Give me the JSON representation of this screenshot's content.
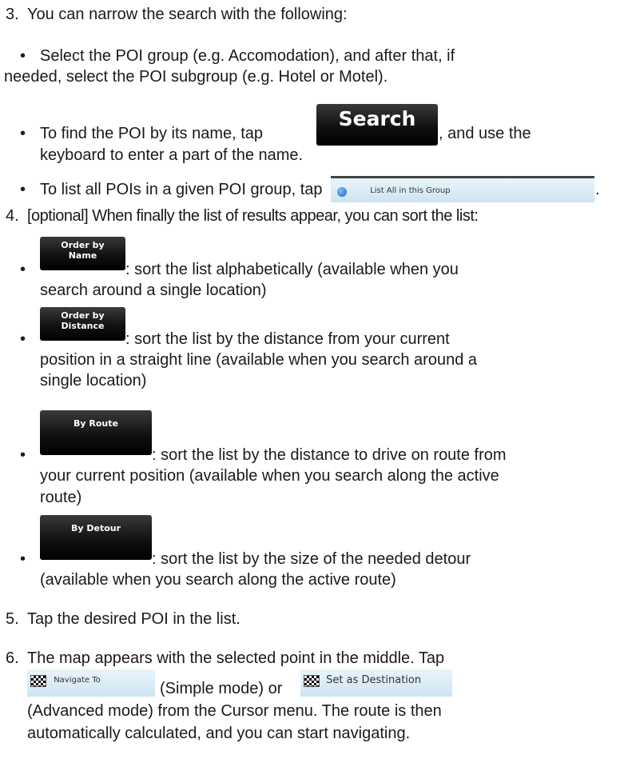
{
  "items": {
    "s3": {
      "num": "3.",
      "text": "You can narrow the search with the following:",
      "b1": {
        "line1": "Select the POI group (e.g. Accomodation), and after that, if",
        "line2": "needed, select the POI subgroup (e.g. Hotel or Motel)."
      },
      "b2": {
        "pre": "To find the POI by its name, tap",
        "button": "Search",
        "post": ", and use the",
        "line2": "keyboard to enter a part of the name."
      },
      "b3": {
        "pre": "To list all POIs in a given POI group, tap",
        "button": "List All in this Group",
        "post": "."
      }
    },
    "s4": {
      "num": "4.",
      "text": "[optional] When finally the list of results appear, you can sort the list:",
      "name": {
        "btn1": "Order by",
        "btn2": "Name",
        "text": ": sort the list alphabetically (available when you",
        "line2": "search around a single location)"
      },
      "distance": {
        "btn1": "Order by",
        "btn2": "Distance",
        "text": ": sort the list by the distance from your current",
        "line2": "position in a straight line (available when you search around a",
        "line3": "single location)"
      },
      "route": {
        "btn": "By Route",
        "text": ": sort the list by the distance to drive on route from",
        "line2": "your current position (available when you search along the active",
        "line3": "route)"
      },
      "detour": {
        "btn": "By Detour",
        "text": ": sort the list by the size of the needed detour",
        "line2": "(available when you search along the active route)"
      }
    },
    "s5": {
      "num": "5.",
      "text": "Tap the desired POI in the list."
    },
    "s6": {
      "num": "6.",
      "line1": "The map appears with the selected point in the middle. Tap",
      "navigate_btn": "Navigate To",
      "simple": "(Simple mode) or",
      "dest_btn": "Set as Destination",
      "line3": "(Advanced mode) from the Cursor menu. The route is then",
      "line4": "automatically calculated, and you can start navigating."
    }
  },
  "bullet": "•"
}
